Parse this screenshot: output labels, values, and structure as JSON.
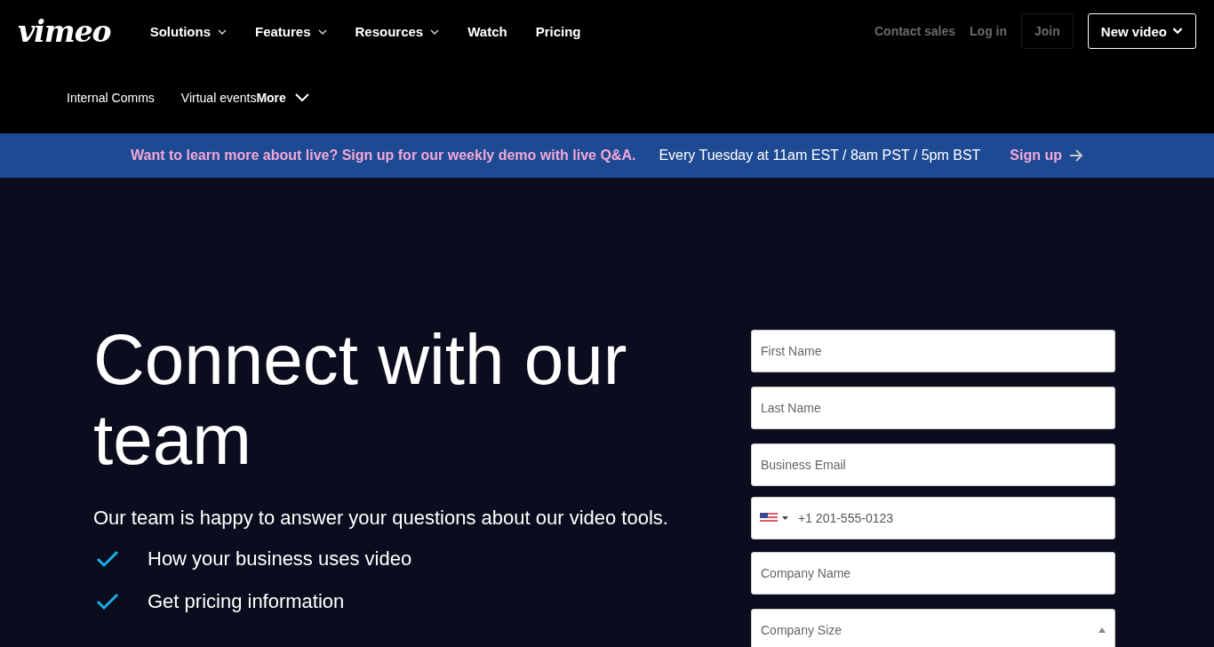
{
  "logo": "vimeo",
  "nav": [
    {
      "label": "Solutions",
      "dropdown": true
    },
    {
      "label": "Features",
      "dropdown": true
    },
    {
      "label": "Resources",
      "dropdown": true
    },
    {
      "label": "Watch",
      "dropdown": false
    },
    {
      "label": "Pricing",
      "dropdown": false
    }
  ],
  "account_links": [
    "Contact sales",
    "Log in"
  ],
  "join_button": "Join",
  "new_video_button": "New video",
  "subnav": {
    "items": [
      "Internal Comms",
      "Virtual events"
    ],
    "more": "More"
  },
  "banner": {
    "headline": "Want to learn more about live? Sign up for our weekly demo with live Q&A.",
    "schedule": "Every Tuesday at 11am EST / 8am PST / 5pm BST",
    "link": "Sign up"
  },
  "hero": {
    "title": "Connect with our team",
    "subtitle": "Our team is happy to answer your questions about our video tools.",
    "checklist": [
      "How your business uses video",
      "Get pricing information"
    ]
  },
  "form": [
    {
      "kind": "text",
      "placeholder": "First Name"
    },
    {
      "kind": "text",
      "placeholder": "Last Name"
    },
    {
      "kind": "text",
      "placeholder": "Business Email"
    },
    {
      "kind": "phone",
      "placeholder": "+1 201-555-0123"
    },
    {
      "kind": "text",
      "placeholder": "Company Name"
    },
    {
      "kind": "select",
      "placeholder": "Company Size"
    }
  ]
}
